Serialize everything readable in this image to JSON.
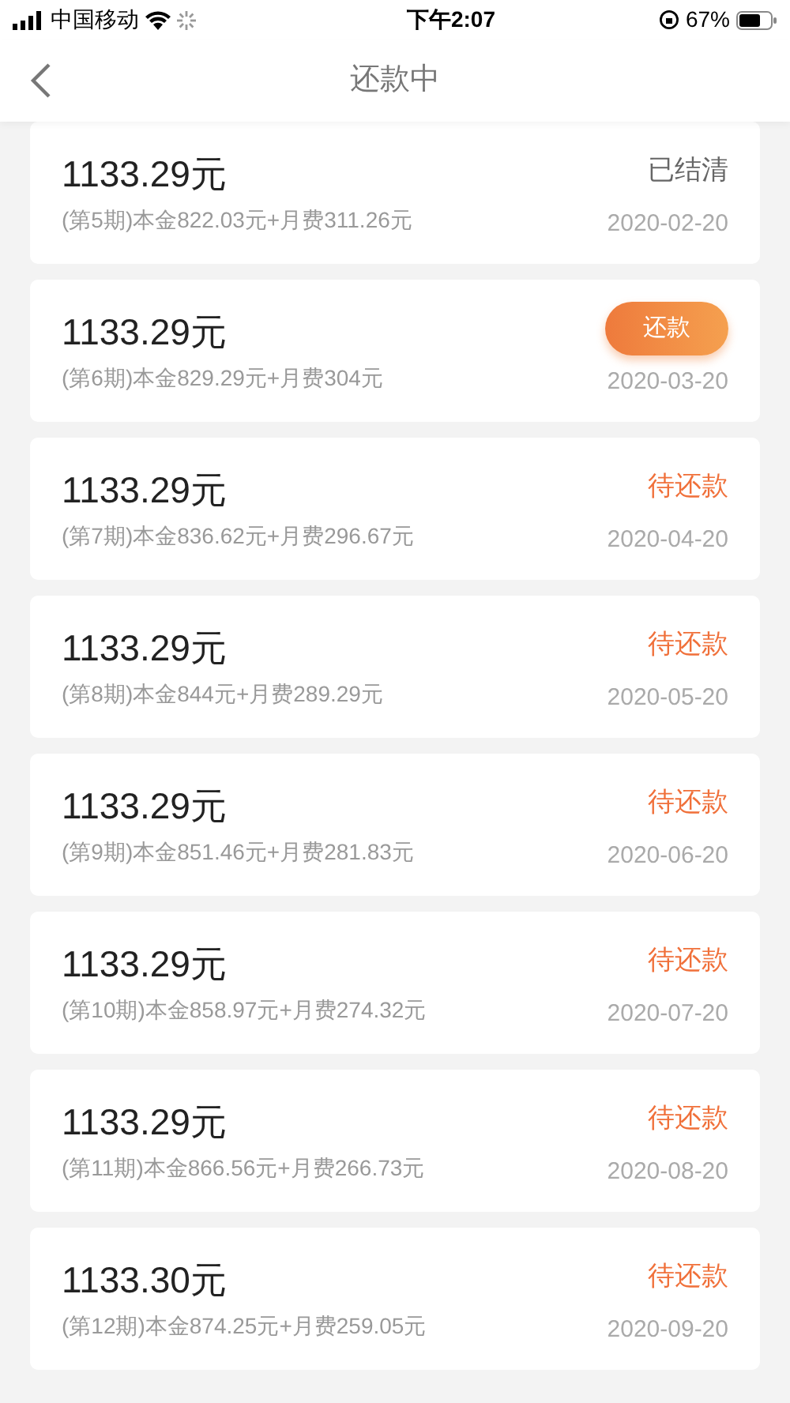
{
  "status_bar": {
    "carrier": "中国移动",
    "time": "下午2:07",
    "battery": "67%"
  },
  "nav": {
    "title": "还款中"
  },
  "installments": [
    {
      "amount": "1133.29元",
      "detail": "(第5期)本金822.03元+月费311.26元",
      "date": "2020-02-20",
      "status": {
        "kind": "settled",
        "label": "已结清"
      }
    },
    {
      "amount": "1133.29元",
      "detail": "(第6期)本金829.29元+月费304元",
      "date": "2020-03-20",
      "status": {
        "kind": "button",
        "label": "还款"
      }
    },
    {
      "amount": "1133.29元",
      "detail": "(第7期)本金836.62元+月费296.67元",
      "date": "2020-04-20",
      "status": {
        "kind": "pending",
        "label": "待还款"
      }
    },
    {
      "amount": "1133.29元",
      "detail": "(第8期)本金844元+月费289.29元",
      "date": "2020-05-20",
      "status": {
        "kind": "pending",
        "label": "待还款"
      }
    },
    {
      "amount": "1133.29元",
      "detail": "(第9期)本金851.46元+月费281.83元",
      "date": "2020-06-20",
      "status": {
        "kind": "pending",
        "label": "待还款"
      }
    },
    {
      "amount": "1133.29元",
      "detail": "(第10期)本金858.97元+月费274.32元",
      "date": "2020-07-20",
      "status": {
        "kind": "pending",
        "label": "待还款"
      }
    },
    {
      "amount": "1133.29元",
      "detail": "(第11期)本金866.56元+月费266.73元",
      "date": "2020-08-20",
      "status": {
        "kind": "pending",
        "label": "待还款"
      }
    },
    {
      "amount": "1133.30元",
      "detail": "(第12期)本金874.25元+月费259.05元",
      "date": "2020-09-20",
      "status": {
        "kind": "pending",
        "label": "待还款"
      }
    }
  ]
}
